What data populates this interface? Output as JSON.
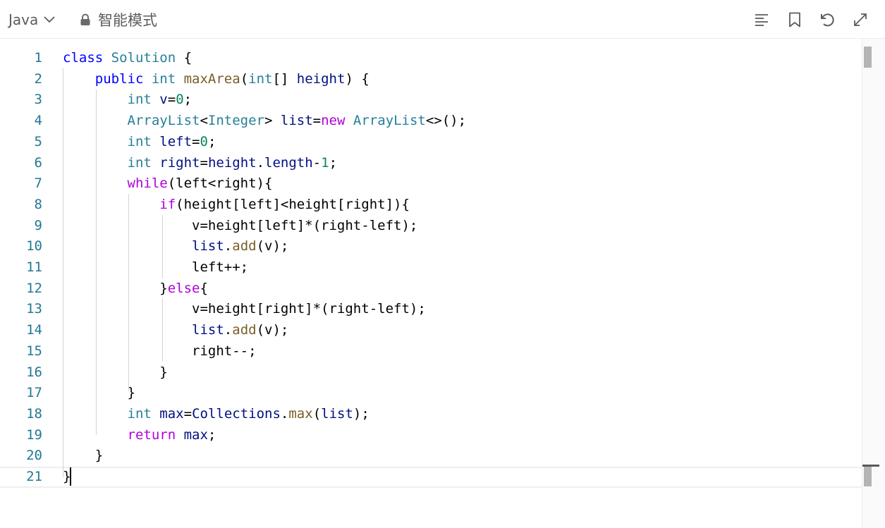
{
  "toolbar": {
    "language": "Java",
    "mode_label": "智能模式",
    "icons": [
      "format-icon",
      "bookmark-icon",
      "undo-icon",
      "expand-icon"
    ]
  },
  "colors": {
    "keyword": "#0000ff",
    "control": "#af00db",
    "type": "#267f99",
    "function": "#795e26",
    "variable": "#001080",
    "number": "#098658",
    "line_number": "#237893"
  },
  "editor": {
    "lines": [
      {
        "n": "1",
        "tokens": [
          [
            "class ",
            "k-blue"
          ],
          [
            "Solution ",
            "k-type"
          ],
          [
            "{",
            "k-plain"
          ]
        ]
      },
      {
        "n": "2",
        "tokens": [
          [
            "    ",
            "k-plain"
          ],
          [
            "public ",
            "k-blue"
          ],
          [
            "int ",
            "k-type"
          ],
          [
            "maxArea",
            "k-fn"
          ],
          [
            "(",
            "k-plain"
          ],
          [
            "int",
            "k-type"
          ],
          [
            "[] ",
            "k-plain"
          ],
          [
            "height",
            "k-var"
          ],
          [
            ") {",
            "k-plain"
          ]
        ]
      },
      {
        "n": "3",
        "tokens": [
          [
            "        ",
            "k-plain"
          ],
          [
            "int ",
            "k-type"
          ],
          [
            "v",
            "k-var"
          ],
          [
            "=",
            "k-plain"
          ],
          [
            "0",
            "k-num"
          ],
          [
            ";",
            "k-plain"
          ]
        ]
      },
      {
        "n": "4",
        "tokens": [
          [
            "        ",
            "k-plain"
          ],
          [
            "ArrayList",
            "k-type"
          ],
          [
            "<",
            "k-plain"
          ],
          [
            "Integer",
            "k-type"
          ],
          [
            "> ",
            "k-plain"
          ],
          [
            "list",
            "k-var"
          ],
          [
            "=",
            "k-plain"
          ],
          [
            "new ",
            "k-purple"
          ],
          [
            "ArrayList",
            "k-type"
          ],
          [
            "<>();",
            "k-plain"
          ]
        ]
      },
      {
        "n": "5",
        "tokens": [
          [
            "        ",
            "k-plain"
          ],
          [
            "int ",
            "k-type"
          ],
          [
            "left",
            "k-var"
          ],
          [
            "=",
            "k-plain"
          ],
          [
            "0",
            "k-num"
          ],
          [
            ";",
            "k-plain"
          ]
        ]
      },
      {
        "n": "6",
        "tokens": [
          [
            "        ",
            "k-plain"
          ],
          [
            "int ",
            "k-type"
          ],
          [
            "right",
            "k-var"
          ],
          [
            "=",
            "k-plain"
          ],
          [
            "height",
            "k-var"
          ],
          [
            ".",
            "k-plain"
          ],
          [
            "length",
            "k-var"
          ],
          [
            "-",
            "k-plain"
          ],
          [
            "1",
            "k-num"
          ],
          [
            ";",
            "k-plain"
          ]
        ]
      },
      {
        "n": "7",
        "tokens": [
          [
            "        ",
            "k-plain"
          ],
          [
            "while",
            "k-purple"
          ],
          [
            "(left<right){",
            "k-plain"
          ]
        ]
      },
      {
        "n": "8",
        "tokens": [
          [
            "            ",
            "k-plain"
          ],
          [
            "if",
            "k-purple"
          ],
          [
            "(height[left]<height[right]){",
            "k-plain"
          ]
        ]
      },
      {
        "n": "9",
        "tokens": [
          [
            "                ",
            "k-plain"
          ],
          [
            "v=height[left]*(right-left);",
            "k-plain"
          ]
        ]
      },
      {
        "n": "10",
        "tokens": [
          [
            "                ",
            "k-plain"
          ],
          [
            "list",
            "k-var"
          ],
          [
            ".",
            "k-plain"
          ],
          [
            "add",
            "k-fn"
          ],
          [
            "(v);",
            "k-plain"
          ]
        ]
      },
      {
        "n": "11",
        "tokens": [
          [
            "                ",
            "k-plain"
          ],
          [
            "left++;",
            "k-plain"
          ]
        ]
      },
      {
        "n": "12",
        "tokens": [
          [
            "            ",
            "k-plain"
          ],
          [
            "}",
            "k-plain"
          ],
          [
            "else",
            "k-purple"
          ],
          [
            "{",
            "k-plain"
          ]
        ]
      },
      {
        "n": "13",
        "tokens": [
          [
            "                ",
            "k-plain"
          ],
          [
            "v=height[right]*(right-left);",
            "k-plain"
          ]
        ]
      },
      {
        "n": "14",
        "tokens": [
          [
            "                ",
            "k-plain"
          ],
          [
            "list",
            "k-var"
          ],
          [
            ".",
            "k-plain"
          ],
          [
            "add",
            "k-fn"
          ],
          [
            "(v);",
            "k-plain"
          ]
        ]
      },
      {
        "n": "15",
        "tokens": [
          [
            "                ",
            "k-plain"
          ],
          [
            "right--;",
            "k-plain"
          ]
        ]
      },
      {
        "n": "16",
        "tokens": [
          [
            "            ",
            "k-plain"
          ],
          [
            "}",
            "k-plain"
          ]
        ]
      },
      {
        "n": "17",
        "tokens": [
          [
            "        ",
            "k-plain"
          ],
          [
            "}",
            "k-plain"
          ]
        ]
      },
      {
        "n": "18",
        "tokens": [
          [
            "        ",
            "k-plain"
          ],
          [
            "int ",
            "k-type"
          ],
          [
            "max",
            "k-var"
          ],
          [
            "=",
            "k-plain"
          ],
          [
            "Collections",
            "k-var"
          ],
          [
            ".",
            "k-plain"
          ],
          [
            "max",
            "k-fn"
          ],
          [
            "(",
            "k-plain"
          ],
          [
            "list",
            "k-var"
          ],
          [
            ");",
            "k-plain"
          ]
        ]
      },
      {
        "n": "19",
        "tokens": [
          [
            "        ",
            "k-plain"
          ],
          [
            "return ",
            "k-purple"
          ],
          [
            "max",
            "k-var"
          ],
          [
            ";",
            "k-plain"
          ]
        ]
      },
      {
        "n": "20",
        "tokens": [
          [
            "    ",
            "k-plain"
          ],
          [
            "}",
            "k-plain"
          ]
        ]
      },
      {
        "n": "21",
        "tokens": [
          [
            "}",
            "k-plain"
          ]
        ]
      }
    ]
  }
}
